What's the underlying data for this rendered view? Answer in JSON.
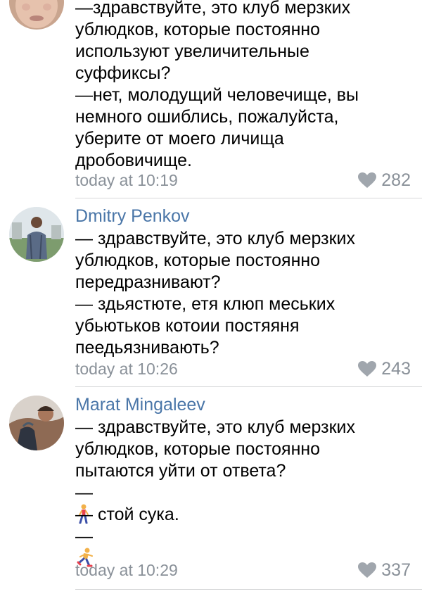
{
  "comments": [
    {
      "lines": [
        "—здравствуйте, это клуб мерзких",
        "ублюдков, которые постоянно",
        "используют увеличительные",
        "суффиксы?",
        "—нет, молодущий человечище, вы",
        "немного ошиблись, пожалуйста,",
        "уберите от моего личища",
        "дробовичище."
      ],
      "time": "today at 10:19",
      "likes": "282",
      "avatar_icon": "user-avatar-photo"
    },
    {
      "author": "Dmitry Penkov",
      "lines": [
        "— здравствуйте, это клуб мерзких",
        "ублюдков, которые постоянно",
        "передразнивают?",
        "— здьястюте, етя клюп меських",
        "убьютьков котоии постяяня",
        "пеедьязнивають?"
      ],
      "time": "today at 10:26",
      "likes": "243",
      "avatar_icon": "user-avatar-photo"
    },
    {
      "author": "Marat Mingaleev",
      "lines": [
        "— здравствуйте, это клуб мерзких",
        "ублюдков, которые постоянно",
        "пытаются уйти от ответа?"
      ],
      "dash": "—",
      "walker_icon": "person-walking-emoji",
      "line_stop": "— стой сука.",
      "runner_icon": "person-running-emoji",
      "time": "today at 10:29",
      "likes": "337",
      "avatar_icon": "user-avatar-photo"
    }
  ],
  "icons": {
    "like": "heart-icon",
    "like_color": "#a0a6ad"
  },
  "colors": {
    "author": "#4a76a8",
    "meta": "#8a9199",
    "divider": "#d7d8d9"
  }
}
